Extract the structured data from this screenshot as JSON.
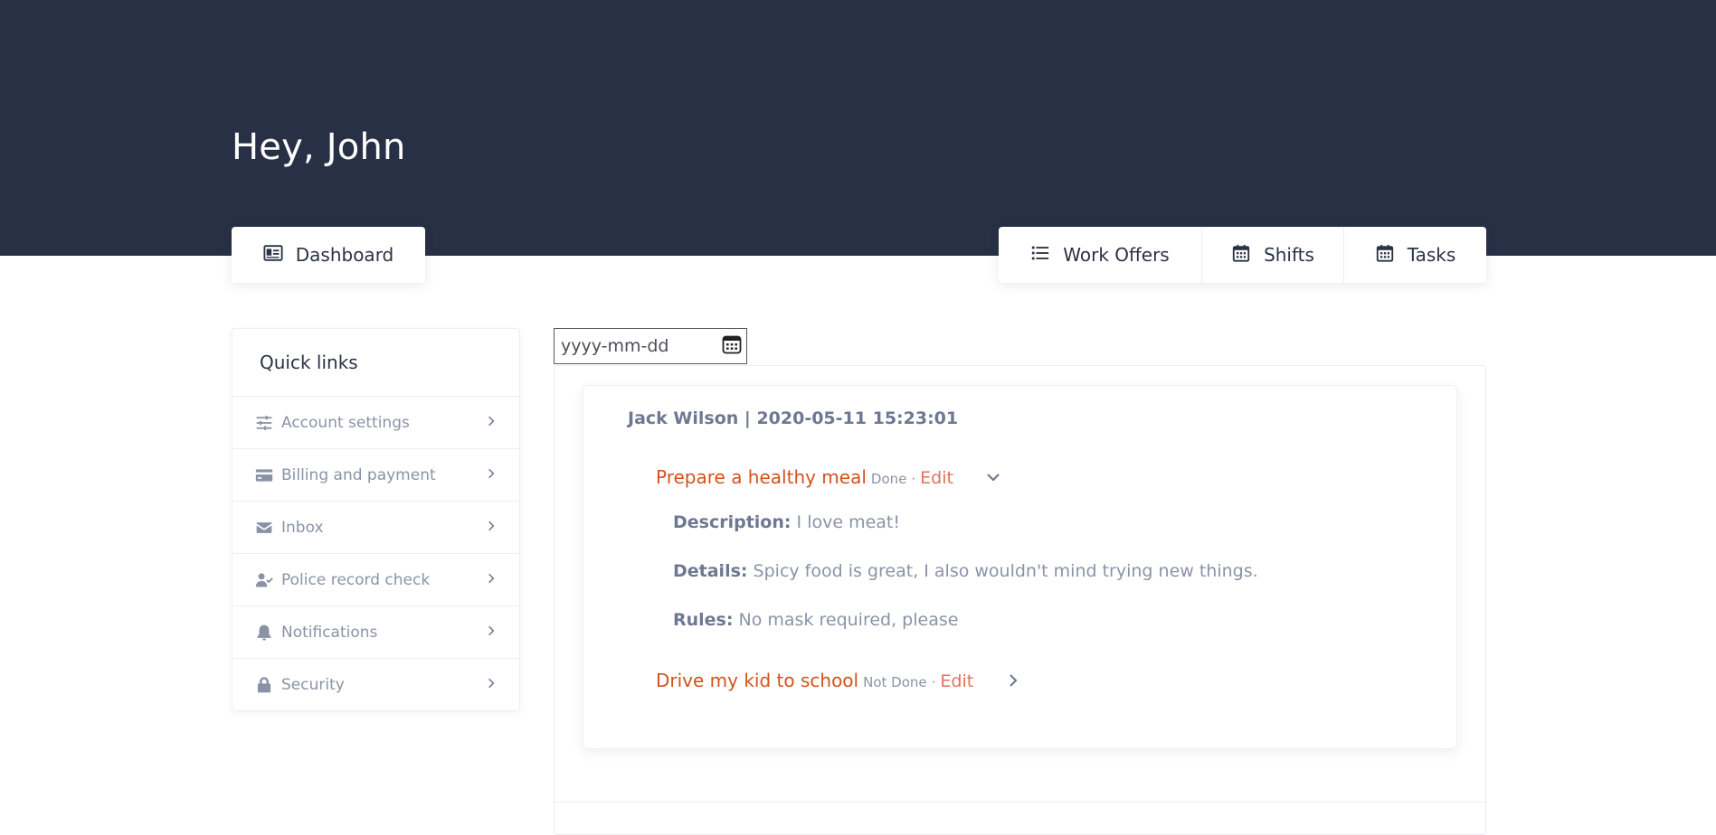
{
  "header": {
    "greeting": "Hey, John"
  },
  "tabs_left": [
    {
      "label": "Dashboard",
      "icon": "id-card-icon"
    }
  ],
  "tabs_right": [
    {
      "label": "Work Offers",
      "icon": "list-icon"
    },
    {
      "label": "Shifts",
      "icon": "calendar-icon"
    },
    {
      "label": "Tasks",
      "icon": "calendar-icon"
    }
  ],
  "quick_links": {
    "title": "Quick links",
    "items": [
      {
        "label": "Account settings",
        "icon": "sliders-icon"
      },
      {
        "label": "Billing and payment",
        "icon": "credit-card-icon"
      },
      {
        "label": "Inbox",
        "icon": "envelope-icon"
      },
      {
        "label": "Police record check",
        "icon": "user-check-icon"
      },
      {
        "label": "Notifications",
        "icon": "bell-icon"
      },
      {
        "label": "Security",
        "icon": "lock-icon"
      }
    ]
  },
  "date_filter": {
    "placeholder": "yyyy-mm-dd"
  },
  "entry": {
    "header": "Jack Wilson | 2020-05-11 15:23:01",
    "tasks": [
      {
        "title": "Prepare a healthy meal",
        "status": "Done",
        "separator": "·",
        "edit_label": "Edit",
        "expanded": true,
        "details": [
          {
            "label": "Description:",
            "value": "I love meat!"
          },
          {
            "label": "Details:",
            "value": "Spicy food is great, I also wouldn't mind trying new things."
          },
          {
            "label": "Rules:",
            "value": "No mask required, please"
          }
        ]
      },
      {
        "title": "Drive my kid to school",
        "status": "Not Done",
        "separator": "·",
        "edit_label": "Edit",
        "expanded": false
      }
    ]
  },
  "colors": {
    "header_bg": "#283046",
    "task_title": "#d4521c",
    "edit_link": "#e07356",
    "muted_text": "#8a93a6"
  }
}
